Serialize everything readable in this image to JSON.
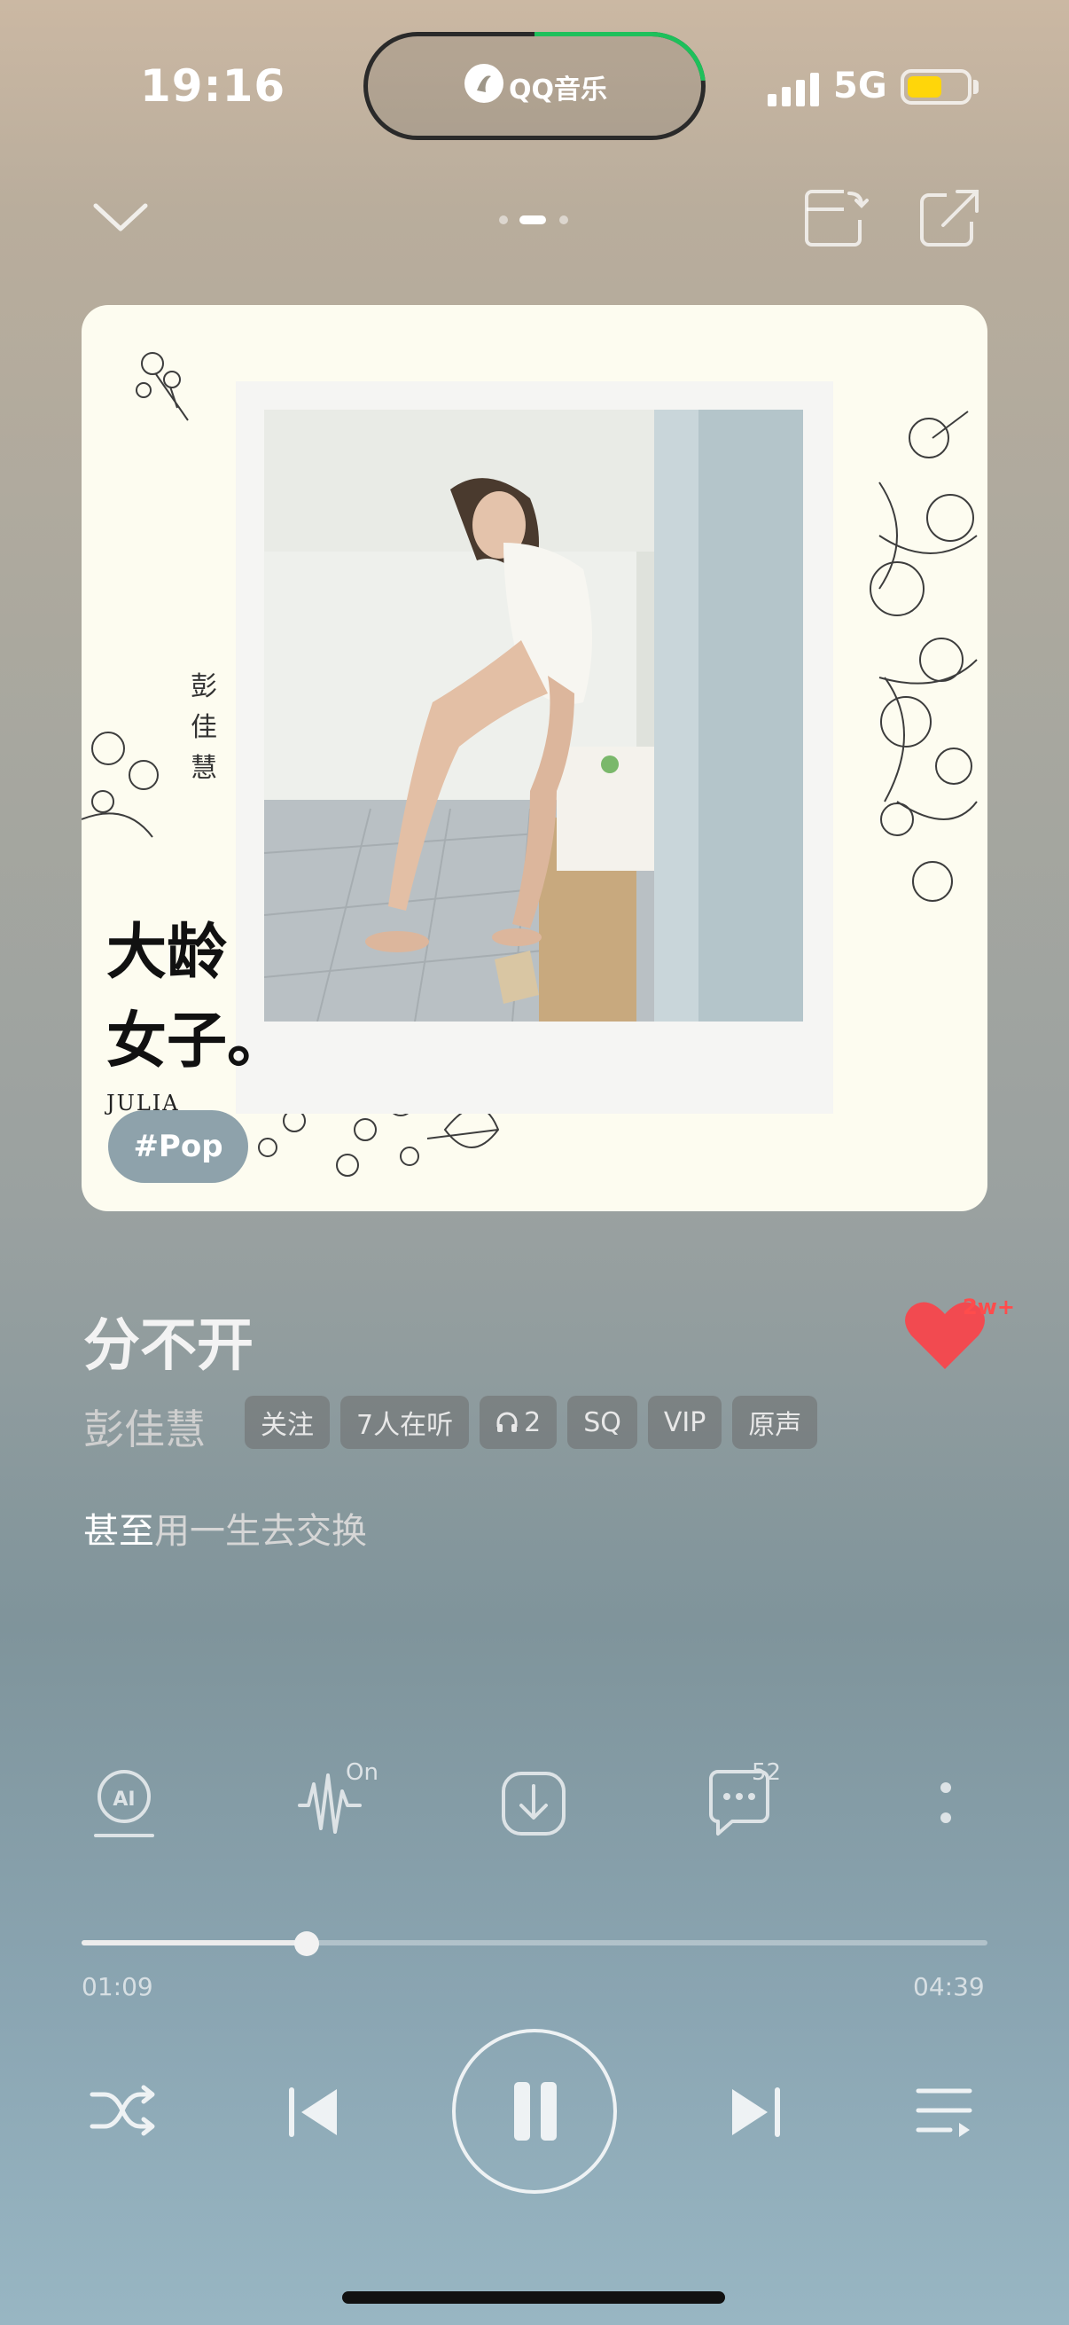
{
  "status": {
    "time": "19:16",
    "island_app": "QQ音乐",
    "network": "5G",
    "accent_progress_color": "#1ec05b",
    "battery_color": "#ffd60a"
  },
  "nav": {
    "collapse_icon": "chevron-down-icon",
    "page_indicator": {
      "pages": 3,
      "active": 1
    },
    "icons": [
      "share-to-device-icon",
      "share-icon"
    ]
  },
  "album": {
    "artist_vertical": "彭佳慧",
    "title_line1": "大龄",
    "title_line2": "女子。",
    "english": "JULIA",
    "genre_tag": "#Pop"
  },
  "song": {
    "title": "分不开",
    "artist": "彭佳慧",
    "like_count": "2w+",
    "badges": [
      "关注",
      "7人在听",
      "2",
      "SQ",
      "VIP",
      "原声"
    ],
    "lyric_highlight": "甚至",
    "lyric_rest": "用一生去交换"
  },
  "actions": {
    "wave_badge": "On",
    "comment_count": "52"
  },
  "progress": {
    "current": "01:09",
    "total": "04:39",
    "fraction": 0.247
  }
}
